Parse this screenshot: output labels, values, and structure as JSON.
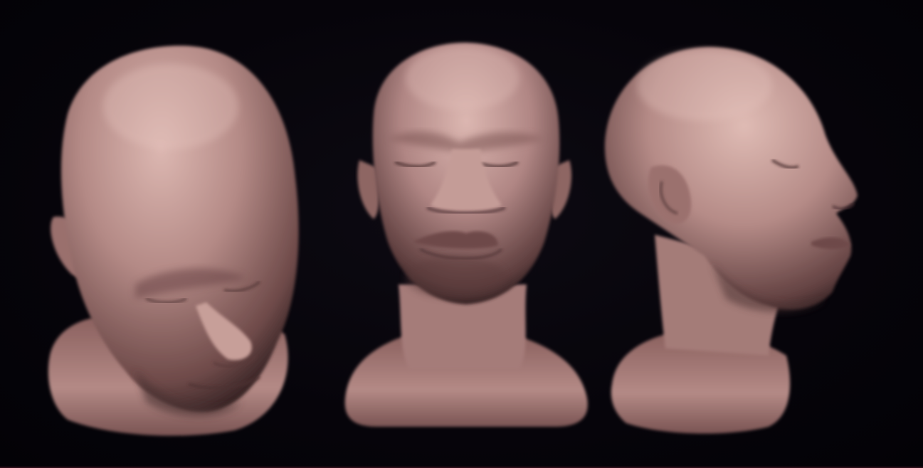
{
  "scene": {
    "background_color": "#050309",
    "skin_base_color": "#b48a86",
    "skin_highlight_color": "#d8b3ad",
    "skin_shadow_color": "#5a3c3c",
    "views": [
      {
        "name": "top-three-quarter-view"
      },
      {
        "name": "front-view"
      },
      {
        "name": "side-profile-view"
      }
    ]
  }
}
